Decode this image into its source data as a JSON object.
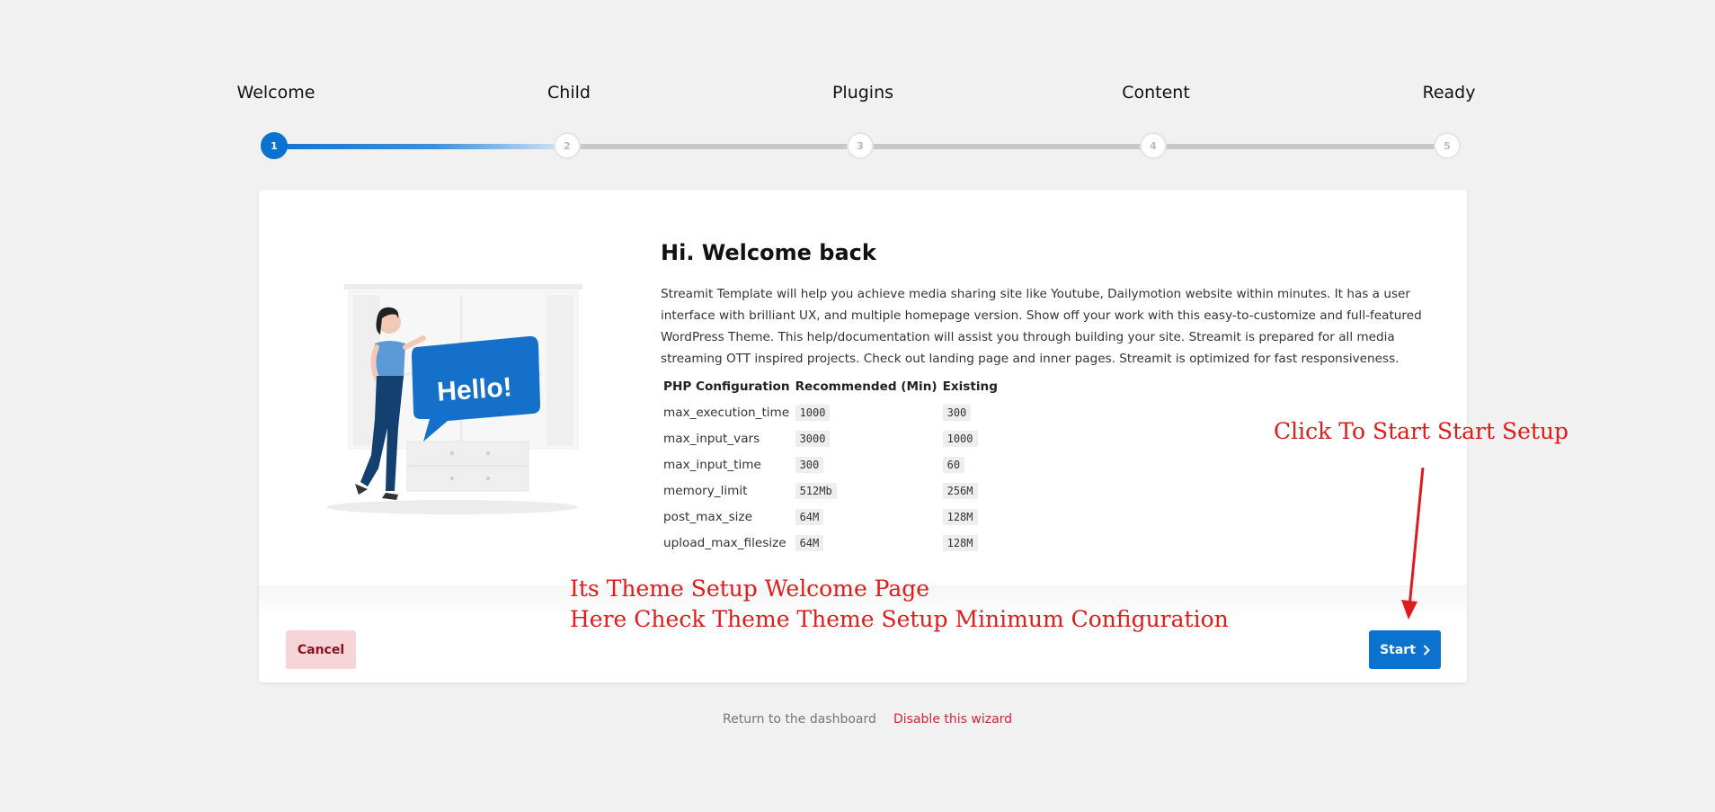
{
  "steps": [
    {
      "label": "Welcome",
      "number": "1",
      "state": "active"
    },
    {
      "label": "Child",
      "number": "2",
      "state": "inactive"
    },
    {
      "label": "Plugins",
      "number": "3",
      "state": "inactive"
    },
    {
      "label": "Content",
      "number": "4",
      "state": "inactive"
    },
    {
      "label": "Ready",
      "number": "5",
      "state": "inactive"
    }
  ],
  "welcome": {
    "title": "Hi. Welcome back",
    "description": "Streamit Template will help you achieve media sharing site like Youtube, Dailymotion website within minutes. It has a user interface with brilliant UX, and multiple homepage version. Show off your work with this easy-to-customize and full-featured WordPress Theme. This help/documentation will assist you through building your site. Streamit is prepared for all media streaming OTT inspired projects. Check out landing page and inner pages. Streamit is optimized for fast responsiveness.",
    "illustration_text": "Hello!"
  },
  "config": {
    "headers": [
      "PHP Configuration",
      "Recommended (Min)",
      "Existing"
    ],
    "rows": [
      {
        "name": "max_execution_time",
        "recommended": "1000",
        "existing": "300"
      },
      {
        "name": "max_input_vars",
        "recommended": "3000",
        "existing": "1000"
      },
      {
        "name": "max_input_time",
        "recommended": "300",
        "existing": "60"
      },
      {
        "name": "memory_limit",
        "recommended": "512Mb",
        "existing": "256M"
      },
      {
        "name": "post_max_size",
        "recommended": "64M",
        "existing": "128M"
      },
      {
        "name": "upload_max_filesize",
        "recommended": "64M",
        "existing": "128M"
      }
    ]
  },
  "buttons": {
    "cancel": "Cancel",
    "start": "Start"
  },
  "footer": {
    "dashboard": "Return to the dashboard",
    "disable": "Disable this wizard"
  },
  "annotations": {
    "start_hint": "Click To Start Start Setup",
    "line1": "Its Theme Setup Welcome Page",
    "line2": "Here Check Theme Theme Setup Minimum Configuration"
  },
  "colors": {
    "accent": "#0b72d0",
    "cancel_bg": "#f7d4d7",
    "danger": "#d0283a",
    "annotation": "#e01b1b"
  }
}
